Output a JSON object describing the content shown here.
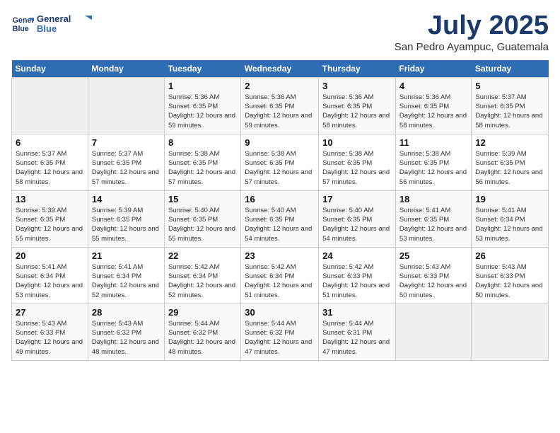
{
  "header": {
    "logo_line1": "General",
    "logo_line2": "Blue",
    "month": "July 2025",
    "location": "San Pedro Ayampuc, Guatemala"
  },
  "weekdays": [
    "Sunday",
    "Monday",
    "Tuesday",
    "Wednesday",
    "Thursday",
    "Friday",
    "Saturday"
  ],
  "weeks": [
    [
      {
        "day": "",
        "sunrise": "",
        "sunset": "",
        "daylight": ""
      },
      {
        "day": "",
        "sunrise": "",
        "sunset": "",
        "daylight": ""
      },
      {
        "day": "1",
        "sunrise": "Sunrise: 5:36 AM",
        "sunset": "Sunset: 6:35 PM",
        "daylight": "Daylight: 12 hours and 59 minutes."
      },
      {
        "day": "2",
        "sunrise": "Sunrise: 5:36 AM",
        "sunset": "Sunset: 6:35 PM",
        "daylight": "Daylight: 12 hours and 59 minutes."
      },
      {
        "day": "3",
        "sunrise": "Sunrise: 5:36 AM",
        "sunset": "Sunset: 6:35 PM",
        "daylight": "Daylight: 12 hours and 58 minutes."
      },
      {
        "day": "4",
        "sunrise": "Sunrise: 5:36 AM",
        "sunset": "Sunset: 6:35 PM",
        "daylight": "Daylight: 12 hours and 58 minutes."
      },
      {
        "day": "5",
        "sunrise": "Sunrise: 5:37 AM",
        "sunset": "Sunset: 6:35 PM",
        "daylight": "Daylight: 12 hours and 58 minutes."
      }
    ],
    [
      {
        "day": "6",
        "sunrise": "Sunrise: 5:37 AM",
        "sunset": "Sunset: 6:35 PM",
        "daylight": "Daylight: 12 hours and 58 minutes."
      },
      {
        "day": "7",
        "sunrise": "Sunrise: 5:37 AM",
        "sunset": "Sunset: 6:35 PM",
        "daylight": "Daylight: 12 hours and 57 minutes."
      },
      {
        "day": "8",
        "sunrise": "Sunrise: 5:38 AM",
        "sunset": "Sunset: 6:35 PM",
        "daylight": "Daylight: 12 hours and 57 minutes."
      },
      {
        "day": "9",
        "sunrise": "Sunrise: 5:38 AM",
        "sunset": "Sunset: 6:35 PM",
        "daylight": "Daylight: 12 hours and 57 minutes."
      },
      {
        "day": "10",
        "sunrise": "Sunrise: 5:38 AM",
        "sunset": "Sunset: 6:35 PM",
        "daylight": "Daylight: 12 hours and 57 minutes."
      },
      {
        "day": "11",
        "sunrise": "Sunrise: 5:38 AM",
        "sunset": "Sunset: 6:35 PM",
        "daylight": "Daylight: 12 hours and 56 minutes."
      },
      {
        "day": "12",
        "sunrise": "Sunrise: 5:39 AM",
        "sunset": "Sunset: 6:35 PM",
        "daylight": "Daylight: 12 hours and 56 minutes."
      }
    ],
    [
      {
        "day": "13",
        "sunrise": "Sunrise: 5:39 AM",
        "sunset": "Sunset: 6:35 PM",
        "daylight": "Daylight: 12 hours and 55 minutes."
      },
      {
        "day": "14",
        "sunrise": "Sunrise: 5:39 AM",
        "sunset": "Sunset: 6:35 PM",
        "daylight": "Daylight: 12 hours and 55 minutes."
      },
      {
        "day": "15",
        "sunrise": "Sunrise: 5:40 AM",
        "sunset": "Sunset: 6:35 PM",
        "daylight": "Daylight: 12 hours and 55 minutes."
      },
      {
        "day": "16",
        "sunrise": "Sunrise: 5:40 AM",
        "sunset": "Sunset: 6:35 PM",
        "daylight": "Daylight: 12 hours and 54 minutes."
      },
      {
        "day": "17",
        "sunrise": "Sunrise: 5:40 AM",
        "sunset": "Sunset: 6:35 PM",
        "daylight": "Daylight: 12 hours and 54 minutes."
      },
      {
        "day": "18",
        "sunrise": "Sunrise: 5:41 AM",
        "sunset": "Sunset: 6:35 PM",
        "daylight": "Daylight: 12 hours and 53 minutes."
      },
      {
        "day": "19",
        "sunrise": "Sunrise: 5:41 AM",
        "sunset": "Sunset: 6:34 PM",
        "daylight": "Daylight: 12 hours and 53 minutes."
      }
    ],
    [
      {
        "day": "20",
        "sunrise": "Sunrise: 5:41 AM",
        "sunset": "Sunset: 6:34 PM",
        "daylight": "Daylight: 12 hours and 53 minutes."
      },
      {
        "day": "21",
        "sunrise": "Sunrise: 5:41 AM",
        "sunset": "Sunset: 6:34 PM",
        "daylight": "Daylight: 12 hours and 52 minutes."
      },
      {
        "day": "22",
        "sunrise": "Sunrise: 5:42 AM",
        "sunset": "Sunset: 6:34 PM",
        "daylight": "Daylight: 12 hours and 52 minutes."
      },
      {
        "day": "23",
        "sunrise": "Sunrise: 5:42 AM",
        "sunset": "Sunset: 6:34 PM",
        "daylight": "Daylight: 12 hours and 51 minutes."
      },
      {
        "day": "24",
        "sunrise": "Sunrise: 5:42 AM",
        "sunset": "Sunset: 6:33 PM",
        "daylight": "Daylight: 12 hours and 51 minutes."
      },
      {
        "day": "25",
        "sunrise": "Sunrise: 5:43 AM",
        "sunset": "Sunset: 6:33 PM",
        "daylight": "Daylight: 12 hours and 50 minutes."
      },
      {
        "day": "26",
        "sunrise": "Sunrise: 5:43 AM",
        "sunset": "Sunset: 6:33 PM",
        "daylight": "Daylight: 12 hours and 50 minutes."
      }
    ],
    [
      {
        "day": "27",
        "sunrise": "Sunrise: 5:43 AM",
        "sunset": "Sunset: 6:33 PM",
        "daylight": "Daylight: 12 hours and 49 minutes."
      },
      {
        "day": "28",
        "sunrise": "Sunrise: 5:43 AM",
        "sunset": "Sunset: 6:32 PM",
        "daylight": "Daylight: 12 hours and 48 minutes."
      },
      {
        "day": "29",
        "sunrise": "Sunrise: 5:44 AM",
        "sunset": "Sunset: 6:32 PM",
        "daylight": "Daylight: 12 hours and 48 minutes."
      },
      {
        "day": "30",
        "sunrise": "Sunrise: 5:44 AM",
        "sunset": "Sunset: 6:32 PM",
        "daylight": "Daylight: 12 hours and 47 minutes."
      },
      {
        "day": "31",
        "sunrise": "Sunrise: 5:44 AM",
        "sunset": "Sunset: 6:31 PM",
        "daylight": "Daylight: 12 hours and 47 minutes."
      },
      {
        "day": "",
        "sunrise": "",
        "sunset": "",
        "daylight": ""
      },
      {
        "day": "",
        "sunrise": "",
        "sunset": "",
        "daylight": ""
      }
    ]
  ]
}
